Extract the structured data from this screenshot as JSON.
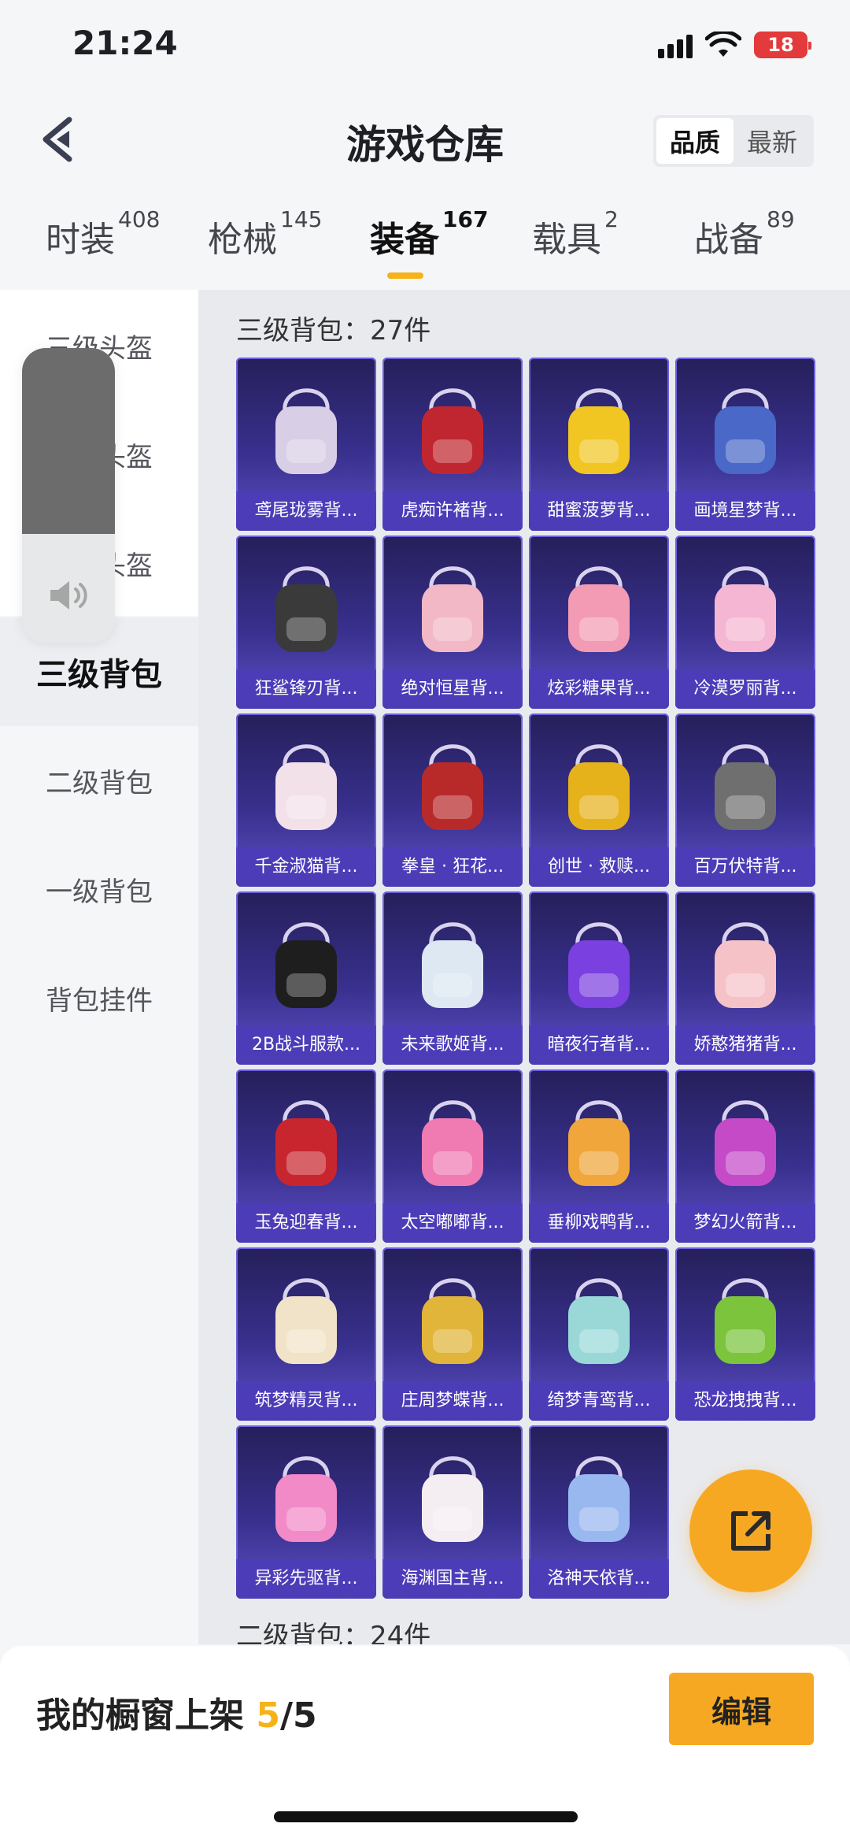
{
  "status_bar": {
    "time": "21:24",
    "battery": "18"
  },
  "header": {
    "title": "游戏仓库",
    "sort_options": [
      "品质",
      "最新"
    ],
    "sort_active": "品质"
  },
  "tabs": [
    {
      "label": "时装",
      "count": "408"
    },
    {
      "label": "枪械",
      "count": "145"
    },
    {
      "label": "装备",
      "count": "167"
    },
    {
      "label": "载具",
      "count": "2"
    },
    {
      "label": "战备",
      "count": "89"
    }
  ],
  "sidebar": {
    "items": [
      {
        "label": "三级头盔"
      },
      {
        "label": "二级头盔"
      },
      {
        "label": "一级头盔"
      },
      {
        "label": "三级背包"
      },
      {
        "label": "二级背包"
      },
      {
        "label": "一级背包"
      },
      {
        "label": "背包挂件"
      }
    ],
    "active": "三级背包"
  },
  "sections": [
    {
      "label": "三级背包：27件"
    },
    {
      "label": "二级背包：24件"
    }
  ],
  "items": [
    {
      "name": "鸢尾珑雾背...",
      "color": "#d8cfe6"
    },
    {
      "name": "虎痴许褚背...",
      "color": "#c0262f"
    },
    {
      "name": "甜蜜菠萝背...",
      "color": "#f1c623"
    },
    {
      "name": "画境星梦背...",
      "color": "#4a68c8"
    },
    {
      "name": "狂鲨锋刃背...",
      "color": "#3a3a3a"
    },
    {
      "name": "绝对恒星背...",
      "color": "#f2b8c6"
    },
    {
      "name": "炫彩糖果背...",
      "color": "#f39bb4"
    },
    {
      "name": "冷漠罗丽背...",
      "color": "#f4b6d2"
    },
    {
      "name": "千金淑猫背...",
      "color": "#f3e1ea"
    },
    {
      "name": "拳皇 · 狂花...",
      "color": "#b82a2a"
    },
    {
      "name": "创世 · 救赎...",
      "color": "#e6b21c"
    },
    {
      "name": "百万伏特背...",
      "color": "#6f6f6f"
    },
    {
      "name": "2B战斗服款...",
      "color": "#1e1e1e"
    },
    {
      "name": "未来歌姬背...",
      "color": "#dde8f2"
    },
    {
      "name": "暗夜行者背...",
      "color": "#7a40e0"
    },
    {
      "name": "娇憨猪猪背...",
      "color": "#f5c2c8"
    },
    {
      "name": "玉兔迎春背...",
      "color": "#c8262e"
    },
    {
      "name": "太空嘟嘟背...",
      "color": "#f07ab2"
    },
    {
      "name": "垂柳戏鸭背...",
      "color": "#f0a63a"
    },
    {
      "name": "梦幻火箭背...",
      "color": "#c44ac8"
    },
    {
      "name": "筑梦精灵背...",
      "color": "#f1e3c8"
    },
    {
      "name": "庄周梦蝶背...",
      "color": "#e1b43a"
    },
    {
      "name": "绮梦青鸾背...",
      "color": "#9ad8d8"
    },
    {
      "name": "恐龙拽拽背...",
      "color": "#7bc43c"
    },
    {
      "name": "异彩先驱背...",
      "color": "#f28ac8"
    },
    {
      "name": "海渊国主背...",
      "color": "#f4eef2"
    },
    {
      "name": "洛神天依背...",
      "color": "#9ab8f0"
    }
  ],
  "bottom_bar": {
    "showcase_label": "我的橱窗上架",
    "current": "5",
    "total": "/5",
    "edit_label": "编辑"
  },
  "icons": {
    "back": "back-arrow-icon",
    "share": "share-external-icon",
    "volume": "speaker-icon"
  },
  "colors": {
    "accent": "#f7a823",
    "card_bg": "#38308d"
  }
}
